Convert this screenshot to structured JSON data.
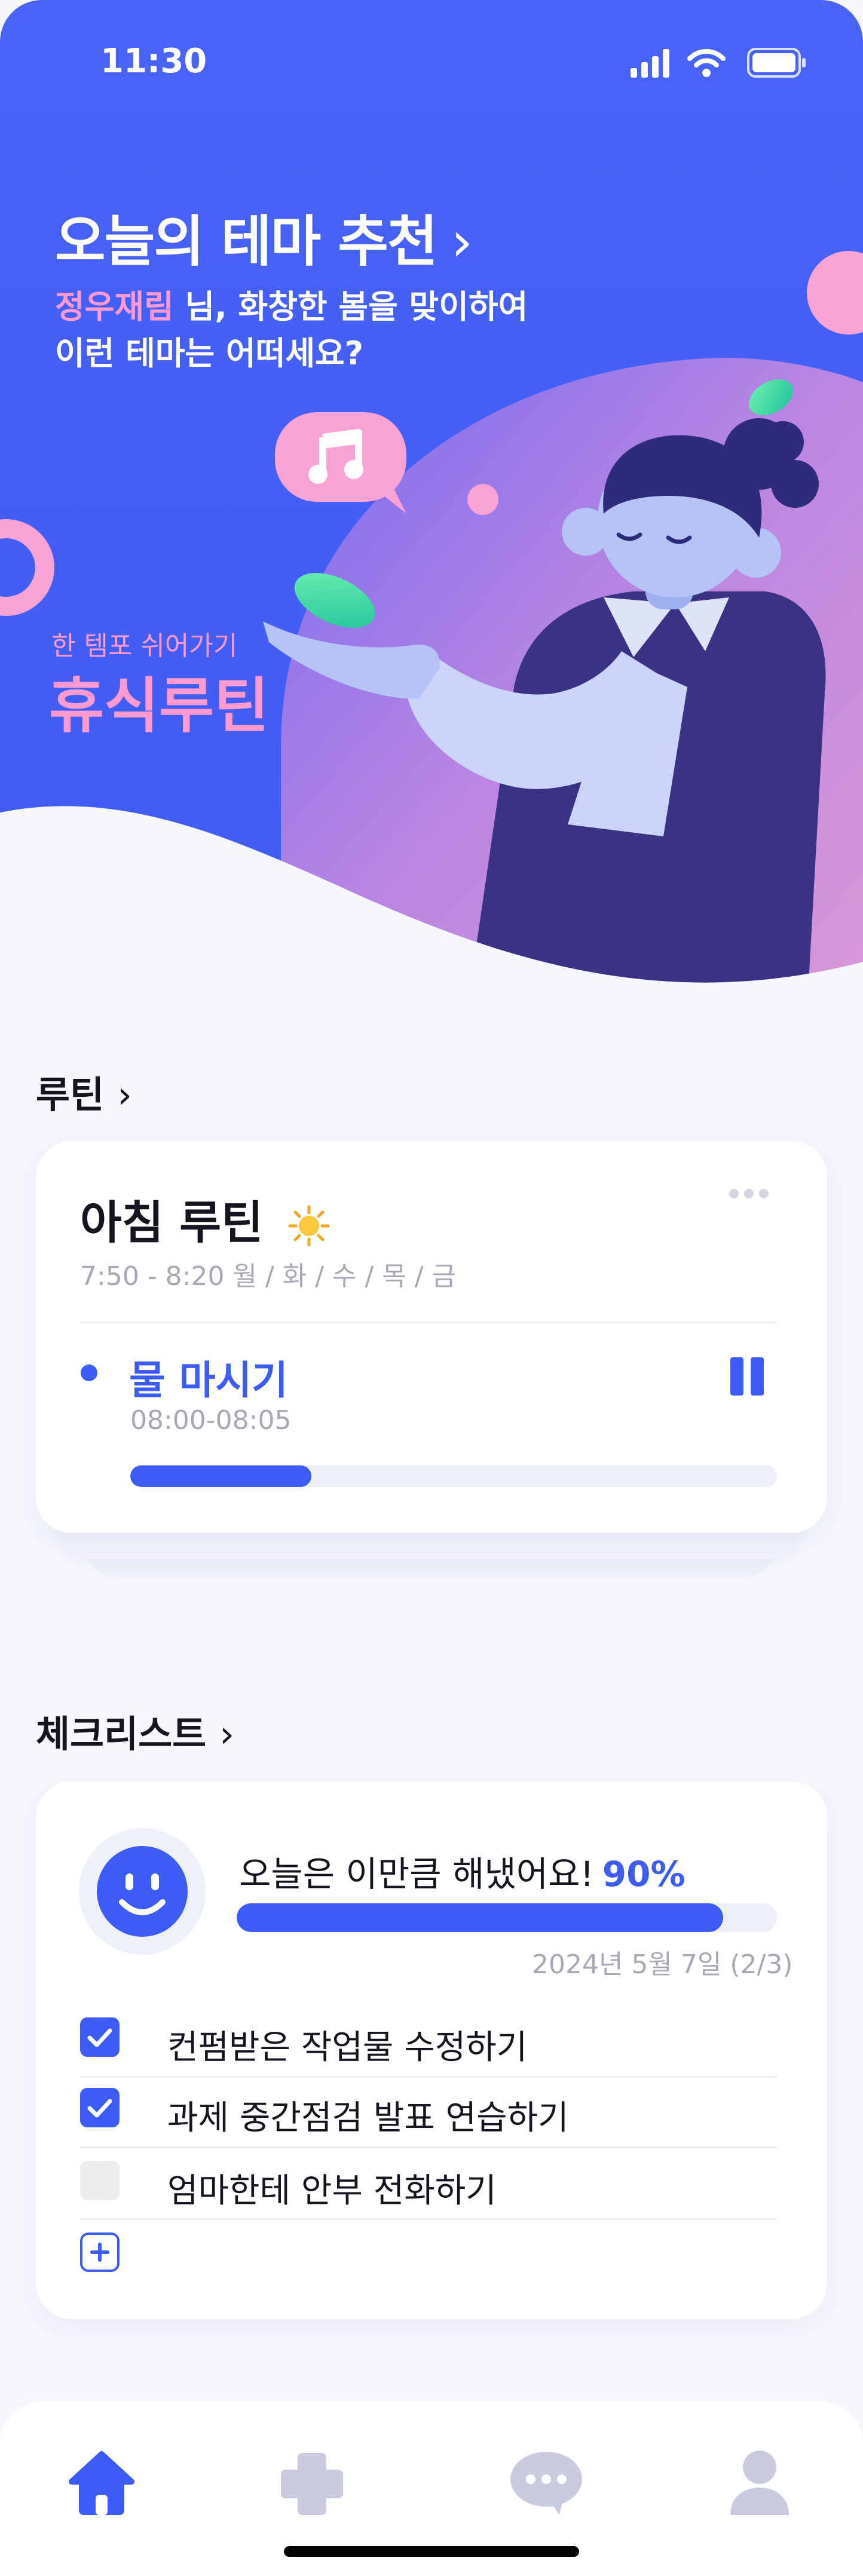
{
  "status_bar": {
    "time": "11:30",
    "icons": [
      "signal-icon",
      "wifi-icon",
      "battery-icon"
    ]
  },
  "hero": {
    "title": "오늘의 테마 추천",
    "title_chevron": "›",
    "user_name": "정우재림",
    "greeting_suffix": " 님, 화창한 봄을 맞이하여",
    "greeting_line2": "이런 테마는 어떠세요?",
    "tempo_label": "한 템포 쉬어가기",
    "routine_name": "휴식루틴"
  },
  "routine_section": {
    "title": "루틴",
    "chevron": "›",
    "card": {
      "name": "아침 루틴",
      "schedule": "7:50 - 8:20 월 / 화 / 수 / 목 / 금",
      "current_task": {
        "name": "물 마시기",
        "time": "08:00-08:05",
        "progress": 0.28
      }
    }
  },
  "checklist_section": {
    "title": "체크리스트",
    "chevron": "›",
    "summary_label": "오늘은 이만큼 해냈어요!",
    "percent_text": "90%",
    "progress": 0.9,
    "date_text": "2024년 5월 7일 (2/3)",
    "items": [
      {
        "label": "컨펌받은 작업물 수정하기",
        "checked": true
      },
      {
        "label": "과제 중간점검 발표 연습하기",
        "checked": true
      },
      {
        "label": "엄마한테 안부 전화하기",
        "checked": false
      }
    ]
  },
  "tab_bar": {
    "tabs": [
      {
        "icon": "home-icon",
        "active": true
      },
      {
        "icon": "plus-icon",
        "active": false
      },
      {
        "icon": "chat-icon",
        "active": false
      },
      {
        "icon": "profile-icon",
        "active": false
      }
    ]
  },
  "colors": {
    "primary": "#3d5bf6",
    "pink": "#ff9ad1",
    "inactive": "#c9cbde",
    "background": "#f6f7fd"
  }
}
